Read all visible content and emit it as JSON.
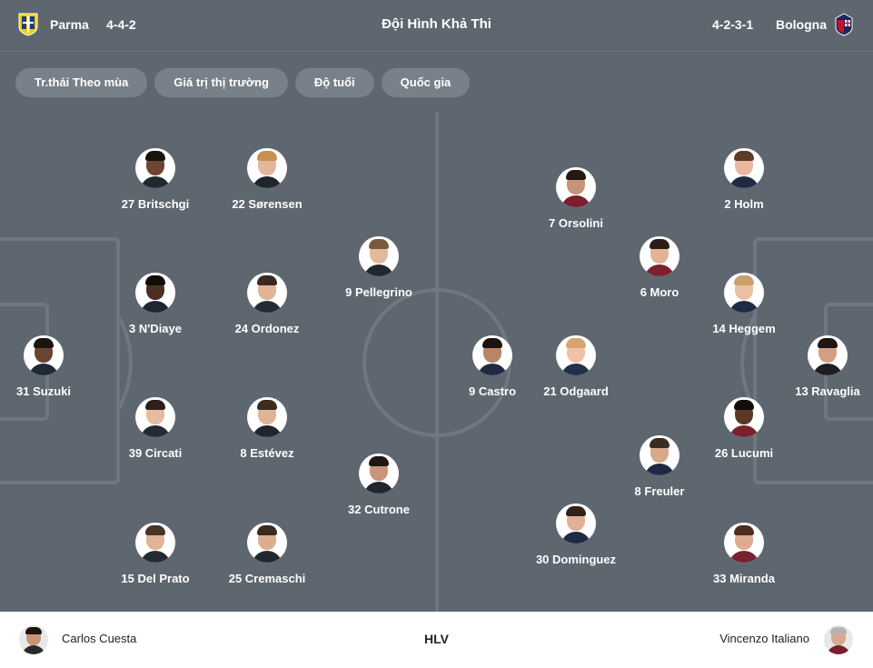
{
  "header": {
    "home_team": "Parma",
    "home_formation": "4-4-2",
    "title": "Đội Hình Khả Thi",
    "away_formation": "4-2-3-1",
    "away_team": "Bologna"
  },
  "filters": [
    "Tr.thái Theo mùa",
    "Giá trị thị trường",
    "Độ tuổi",
    "Quốc gia"
  ],
  "colors": {
    "pitch": "#5e6670",
    "chip": "#78808a",
    "lines": "#6f7781"
  },
  "home_players": [
    {
      "name": "31 Suzuki",
      "skin": "#6b4433",
      "hair": "#1c140f",
      "kit": "#1f2a37"
    },
    {
      "name": "27 Britschgi",
      "skin": "#6e4532",
      "hair": "#1a120d",
      "kit": "#222831"
    },
    {
      "name": "22 Sørensen",
      "skin": "#e4b79c",
      "hair": "#c98f56",
      "kit": "#20252d"
    },
    {
      "name": "3 N'Diaye",
      "skin": "#4a2f22",
      "hair": "#130d09",
      "kit": "#1e2530"
    },
    {
      "name": "24 Ordonez",
      "skin": "#e2b497",
      "hair": "#3a2a20",
      "kit": "#252a33"
    },
    {
      "name": "39 Circati",
      "skin": "#e6bba0",
      "hair": "#2d2019",
      "kit": "#242a32"
    },
    {
      "name": "8 Estévez",
      "skin": "#dfb396",
      "hair": "#3b2b21",
      "kit": "#21262e"
    },
    {
      "name": "15 Del Prato",
      "skin": "#e0b296",
      "hair": "#4a3426",
      "kit": "#262b33"
    },
    {
      "name": "25 Cremaschi",
      "skin": "#dcae90",
      "hair": "#3a2a20",
      "kit": "#23282f"
    },
    {
      "name": "9 Pellegrino",
      "skin": "#e3b89c",
      "hair": "#7a5a3e",
      "kit": "#22272e"
    },
    {
      "name": "32 Cutrone",
      "skin": "#c99478",
      "hair": "#1e1611",
      "kit": "#21262d"
    }
  ],
  "away_players": [
    {
      "name": "7 Orsolini",
      "skin": "#c79478",
      "hair": "#231913",
      "kit": "#7a1f2b"
    },
    {
      "name": "2 Holm",
      "skin": "#e8b9a0",
      "hair": "#5b3b27",
      "kit": "#1f2b45"
    },
    {
      "name": "6 Moro",
      "skin": "#e2b397",
      "hair": "#2a1e17",
      "kit": "#7d2030"
    },
    {
      "name": "14 Heggem",
      "skin": "#ebc0a3",
      "hair": "#c7a06b",
      "kit": "#1d2a44"
    },
    {
      "name": "9 Castro",
      "skin": "#b98566",
      "hair": "#1b130e",
      "kit": "#1f2a42"
    },
    {
      "name": "21 Odgaard",
      "skin": "#efc2a8",
      "hair": "#d6a66f",
      "kit": "#223049"
    },
    {
      "name": "13 Ravaglia",
      "skin": "#d0a083",
      "hair": "#1f1712",
      "kit": "#1e1e22"
    },
    {
      "name": "26 Lucumi",
      "skin": "#5a3826",
      "hair": "#120c08",
      "kit": "#7a1f2b"
    },
    {
      "name": "8 Freuler",
      "skin": "#d8a98b",
      "hair": "#3b2b22",
      "kit": "#1e2a43"
    },
    {
      "name": "30 Dominguez",
      "skin": "#e1b195",
      "hair": "#2f221a",
      "kit": "#1f2a44"
    },
    {
      "name": "33 Miranda",
      "skin": "#ddac8f",
      "hair": "#4c2f1f",
      "kit": "#7b2030"
    }
  ],
  "coaches": {
    "label": "HLV",
    "home": {
      "name": "Carlos Cuesta",
      "skin": "#c69478",
      "hair": "#1d1510",
      "kit": "#2a2a2a"
    },
    "away": {
      "name": "Vincenzo Italiano",
      "skin": "#d9a98c",
      "hair": "#b9b2ac",
      "kit": "#7a1f2b"
    }
  }
}
